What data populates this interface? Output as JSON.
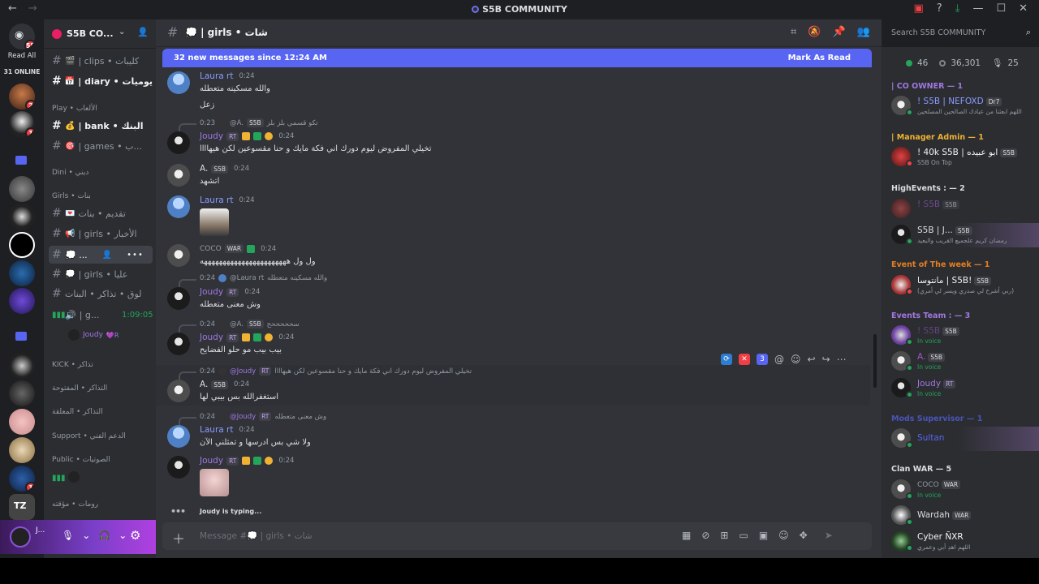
{
  "window": {
    "title": "S5B COMMUNITY",
    "controls": [
      "—",
      "☐",
      "✕"
    ]
  },
  "rail": {
    "read_all": "Read All",
    "online": "31 ONLINE",
    "badges": [
      "55",
      "2",
      "1",
      "1"
    ]
  },
  "sidebar": {
    "guild_name": "S5B CO...",
    "channels": [
      {
        "name": "| clips • كليبات",
        "emoji": "🎬"
      },
      {
        "name": "| diary • يوميات",
        "emoji": "📅"
      },
      {
        "name": "| bank • البنك",
        "emoji": "💰"
      },
      {
        "name": "| games • ب...",
        "emoji": "🎯"
      }
    ],
    "categories": {
      "play": "Play • الألعاب",
      "dini": "Dini • ديني",
      "girls": "Girls • بنات",
      "kick": "KICK • تذاكر",
      "tickets_open": "التذاكر • المفتوحة",
      "tickets_pending": "التذاكر • المعلقة",
      "support": "Support • الدعم الفني",
      "public": "Public • الصوتيات",
      "rooms": "رومات • مؤقته"
    },
    "girls_channels": [
      {
        "name": "تقديم • بنات",
        "emoji": "💌"
      },
      {
        "name": "| girls • الأخبار",
        "emoji": "📢"
      },
      {
        "name": "💭 ...",
        "emoji": "💭"
      },
      {
        "name": "| girls • عليا",
        "emoji": "💭"
      },
      {
        "name": "لوق • تذاكر • البنات",
        "emoji": ""
      }
    ],
    "voice": {
      "name": "| g...",
      "time": "1:09:05",
      "user": "Joudy"
    }
  },
  "user_panel": {
    "name": "J..."
  },
  "chat": {
    "channel_title": "💭 | girls • شات",
    "new_bar": "32 new messages since 12:24 AM",
    "mark_read": "Mark As Read",
    "messages": [
      {
        "author": "Laura rt",
        "time": "0:24",
        "lines": [
          "والله مسكينه متعطله",
          "زعل"
        ],
        "author_color": "#8a9cff"
      },
      {
        "reply_time": "0:23",
        "reply_to": "@A.",
        "reply_tag": "S5B",
        "reply_text": "تكو قسمي بلز بلز",
        "author": "Joudy",
        "tag": "RT",
        "time": "0:24",
        "lines": [
          "تخيلي المفروض ليوم دورك اني فكة مايك و حنا مقسوعين لكن هيهاااا"
        ],
        "author_color": "#a078e0"
      },
      {
        "author": "A.",
        "tag": "S5B",
        "time": "0:24",
        "lines": [
          "اتشهد"
        ],
        "author_color": "#dbdee1"
      },
      {
        "author": "Laura rt",
        "time": "0:24",
        "lines": [],
        "author_color": "#8a9cff"
      },
      {
        "author": "COCO",
        "tag": "WAR",
        "time": "0:24",
        "lines": [
          "ول ول هههههههههههههههههههههههه"
        ],
        "author_color": "#949ba4"
      },
      {
        "reply_time": "0:24",
        "reply_to": "@Laura rt",
        "reply_text": "والله مسكينه متعطله",
        "author": "Joudy",
        "tag": "RT",
        "time": "0:24",
        "lines": [
          "وش معنى متعطله"
        ],
        "author_color": "#a078e0"
      },
      {
        "reply_time": "0:24",
        "reply_to": "@A.",
        "reply_tag": "S5B",
        "reply_text": "سحححححح",
        "author": "Joudy",
        "tag": "RT",
        "time": "0:24",
        "lines": [
          "بيب بيب مو حلو الفضايح"
        ],
        "author_color": "#a078e0"
      },
      {
        "reply_time": "0:24",
        "reply_to": "@Joudy",
        "reply_tag": "RT",
        "reply_text": "تخيلي المفروض ليوم دورك اني فكة مايك و حنا مقسوعين لكن هيهاااا",
        "author": "A.",
        "tag": "S5B",
        "time": "0:24",
        "lines": [
          "استغفرالله بس بيبي لها"
        ],
        "author_color": "#dbdee1"
      },
      {
        "reply_time": "0:24",
        "reply_to": "@Joudy",
        "reply_tag": "RT",
        "reply_text": "وش معنى متعطله",
        "author": "Laura rt",
        "time": "0:24",
        "lines": [
          "ولا شي بس ادرسها و تمثلني الآن"
        ],
        "author_color": "#8a9cff"
      },
      {
        "author": "Joudy",
        "tag": "RT",
        "time": "0:24",
        "lines": [],
        "author_color": "#a078e0"
      }
    ],
    "hover_count": "3",
    "typing": "Joudy is typing...",
    "composer_placeholder": "Message #💭 | girls • شات"
  },
  "members": {
    "search_placeholder": "Search S5B COMMUNITY",
    "stats": {
      "online": "46",
      "members": "36,301",
      "voice": "25"
    },
    "groups": [
      {
        "label": "| CO OWNER — 1",
        "color": "#a078e0"
      },
      {
        "label": "| Manager Admin — 1",
        "color": "#f0b232"
      },
      {
        "label": "HighEvents : — 2",
        "color": "#dbdee1"
      },
      {
        "label": "Event of The week — 1",
        "color": "#e67e22"
      },
      {
        "label": "Events Team : — 3",
        "color": "#a078e0"
      },
      {
        "label": "Mods Supervisor — 1",
        "color": "#5865f2"
      },
      {
        "label": "Clan WAR — 5",
        "color": "#dbdee1"
      }
    ],
    "list": [
      {
        "name": "! S5B | NEFOXD",
        "tag": "Dr7",
        "sub": "اللهم ابعثنا من عبادك الصالحين المصلحين",
        "color": "#8a9cff",
        "status": "#23a55a"
      },
      {
        "name": "! 40k S5B | ابو عبيده",
        "tag": "S5B",
        "sub": "S5B On Top",
        "color": "#f2f3f5",
        "status": "#f23f43"
      },
      {
        "name": "! S5B",
        "tag": "S5B",
        "sub": "",
        "color": "#a05acb",
        "status": "#23a55a"
      },
      {
        "name": "S5B | J...",
        "tag": "S5B",
        "sub": "رمضان كريم علجميع القريب والبعيد",
        "color": "#dbdee1",
        "status": "#23a55a"
      },
      {
        "name": "مانتوسا | S5B!",
        "tag": "S5B",
        "sub": "(ربي أشرح لي صدري ويسر لي أمري)",
        "color": "#f2f3f5",
        "status": "#f23f43"
      },
      {
        "name": "! S5B",
        "tag": "S5B",
        "sub": "In voice",
        "color": "#a05acb",
        "status": "#23a55a"
      },
      {
        "name": "A.",
        "tag": "S5B",
        "sub": "In voice",
        "color": "#a05acb",
        "status": "#23a55a"
      },
      {
        "name": "Joudy",
        "tag": "RT",
        "sub": "In voice",
        "color": "#a078e0",
        "status": "#23a55a"
      },
      {
        "name": "Sultan",
        "tag": "",
        "sub": "",
        "color": "#5865f2",
        "status": "#23a55a"
      },
      {
        "name": "COCO",
        "tag": "WAR",
        "sub": "In voice",
        "color": "#949ba4",
        "status": "#23a55a"
      },
      {
        "name": "Wardah",
        "tag": "WAR",
        "sub": "",
        "color": "#dbdee1",
        "status": "#23a55a"
      },
      {
        "name": "Cyber ÑXR",
        "tag": "",
        "sub": "اللهم اهدِ أبي وعمري",
        "color": "#f2f3f5",
        "status": "#23a55a"
      }
    ]
  }
}
